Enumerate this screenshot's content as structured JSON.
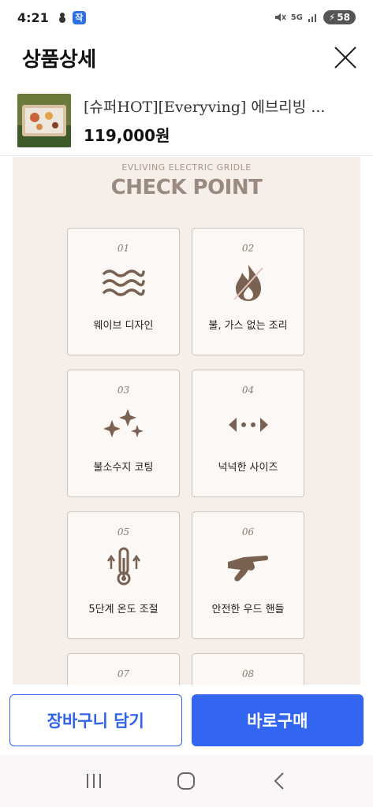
{
  "status": {
    "time": "4:21",
    "app_badge": "작",
    "network": "5G",
    "battery": "58"
  },
  "header": {
    "title": "상품상세"
  },
  "product": {
    "name": "[슈퍼HOT][Everyving] 에브리빙 ...",
    "price": "119,000원"
  },
  "detail": {
    "subtitle": "EVLIVING ELECTRIC GRIDLE",
    "title": "CHECK POINT",
    "cards": [
      {
        "num": "01",
        "label": "웨이브 디자인",
        "icon": "wave-icon"
      },
      {
        "num": "02",
        "label": "불, 가스 없는 조리",
        "icon": "no-fire-icon"
      },
      {
        "num": "03",
        "label": "불소수지 코팅",
        "icon": "sparkle-icon"
      },
      {
        "num": "04",
        "label": "넉넉한 사이즈",
        "icon": "expand-arrows-icon"
      },
      {
        "num": "05",
        "label": "5단계 온도 조절",
        "icon": "thermometer-icon"
      },
      {
        "num": "06",
        "label": "안전한 우드 핸들",
        "icon": "hand-icon"
      },
      {
        "num": "07",
        "label": "",
        "icon": ""
      },
      {
        "num": "08",
        "label": "",
        "icon": ""
      }
    ]
  },
  "actions": {
    "cart_label": "장바구니 담기",
    "buy_label": "바로구매"
  },
  "colors": {
    "accent": "#3366f0",
    "detail_bg": "#f5eee9",
    "icon_brown": "#7a6252"
  }
}
